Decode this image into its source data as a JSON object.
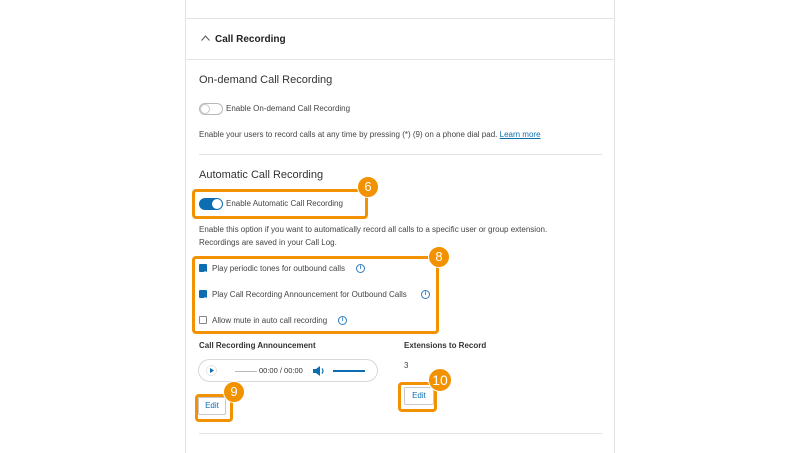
{
  "section": {
    "title": "Call Recording"
  },
  "on_demand": {
    "heading": "On-demand Call Recording",
    "toggle_label": "Enable On-demand Call Recording",
    "toggle_on": false,
    "description": "Enable your users to record calls at any time by pressing (*) (9) on a phone dial pad.",
    "learn_more": "Learn more"
  },
  "automatic": {
    "heading": "Automatic Call Recording",
    "toggle_label": "Enable Automatic Call Recording",
    "toggle_on": true,
    "description_line1": "Enable this option if you want to automatically record all calls to a specific user or group extension.",
    "description_line2": "Recordings are saved in your Call Log.",
    "options": [
      {
        "label": "Play periodic tones for outbound calls",
        "checked": true
      },
      {
        "label": "Play Call Recording Announcement for Outbound Calls",
        "checked": true
      },
      {
        "label": "Allow mute in auto call recording",
        "checked": false
      }
    ]
  },
  "announcement": {
    "heading": "Call Recording Announcement",
    "time": "00:00 / 00:00",
    "edit_label": "Edit"
  },
  "extensions": {
    "heading": "Extensions to Record",
    "count": "3",
    "edit_label": "Edit"
  },
  "callouts": {
    "c6": "6",
    "c8": "8",
    "c9": "9",
    "c10": "10"
  },
  "colors": {
    "accent": "#0c6eb1",
    "callout": "#f39200"
  }
}
